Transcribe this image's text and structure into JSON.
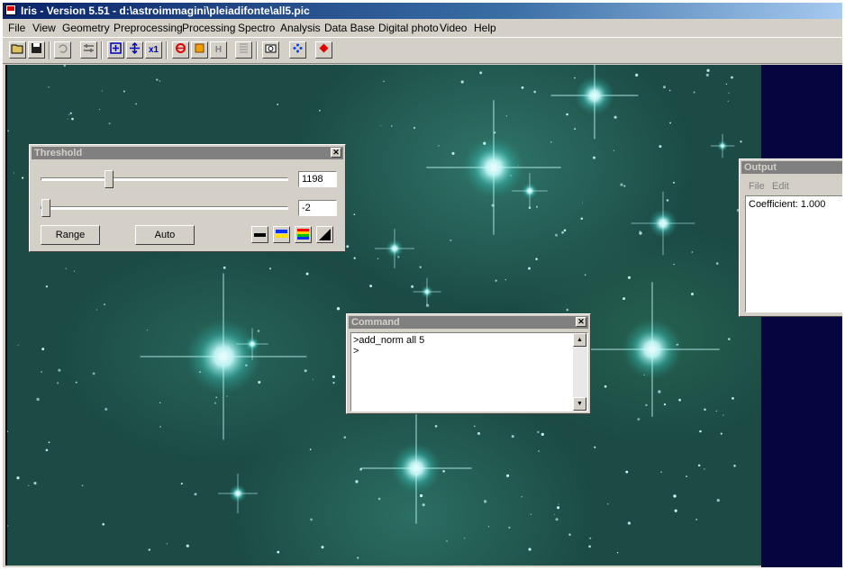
{
  "window": {
    "title": "Iris - Version 5.51 - d:\\astroimmagini\\pleiadifonte\\all5.pic"
  },
  "menu": [
    "File",
    "View",
    "Geometry",
    "Preprocessing",
    "Processing",
    "Spectro",
    "Analysis",
    "Data Base",
    "Digital photo",
    "Video",
    "Help"
  ],
  "toolbar": {
    "icons": [
      "open-folder-icon",
      "save-disk-icon",
      "undo-icon",
      "settings-icon",
      "zoom-in-icon",
      "zoom-out-icon",
      "zoom-1x-icon",
      "refresh-icon",
      "color-square-icon",
      "hist-icon",
      "list-icon",
      "camera-icon",
      "center-stars-icon",
      "record-icon"
    ],
    "zoom_label": "x1",
    "h_label": "H"
  },
  "threshold": {
    "title": "Threshold",
    "high_value": "1198",
    "low_value": "-2",
    "range_label": "Range",
    "auto_label": "Auto"
  },
  "command": {
    "title": "Command",
    "lines": [
      ">add_norm all 5",
      ">"
    ]
  },
  "output": {
    "title": "Output",
    "menu_file": "File",
    "menu_edit": "Edit",
    "text": "Coefficient: 1.000"
  },
  "colors": {
    "sky": "#1c4b45",
    "star": "#e8ffff",
    "title_active": "#0a246a",
    "title_inactive": "#808080"
  }
}
